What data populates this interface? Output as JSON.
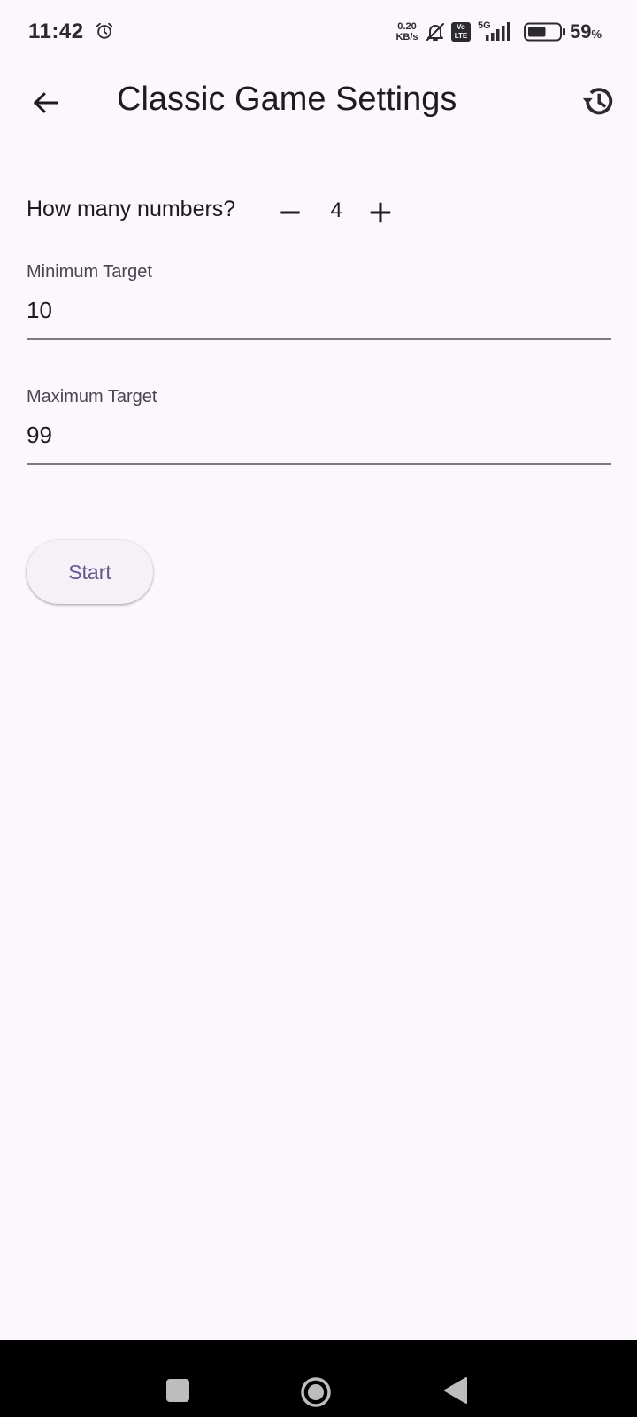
{
  "status_bar": {
    "time": "11:42",
    "net_speed_value": "0.20",
    "net_speed_unit": "KB/s",
    "volte_top": "Vo",
    "volte_bottom": "LTE",
    "network_type": "5G",
    "battery_level": 59,
    "battery_percent": "59",
    "battery_unit": "%",
    "icons": [
      "alarm-icon",
      "mute-icon",
      "volte-icon",
      "signal-icon",
      "battery-icon"
    ]
  },
  "app_bar": {
    "title": "Classic Game Settings",
    "back_icon": "arrow-left-icon",
    "history_icon": "history-icon"
  },
  "settings": {
    "count_label": "How many numbers?",
    "count_value": "4",
    "minimum_target_label": "Minimum Target",
    "minimum_target_value": "10",
    "maximum_target_label": "Maximum Target",
    "maximum_target_value": "99",
    "start_label": "Start"
  },
  "nav_bar": {
    "icons": [
      "recents-icon",
      "home-icon",
      "back-icon"
    ]
  },
  "colors": {
    "background": "#fcf6fd",
    "text_primary": "#1c1b1f",
    "text_secondary": "#49454f",
    "accent": "#65558f",
    "button_surface": "#f6f0f7",
    "underline": "#7d7a80",
    "nav_bar": "#000000"
  }
}
